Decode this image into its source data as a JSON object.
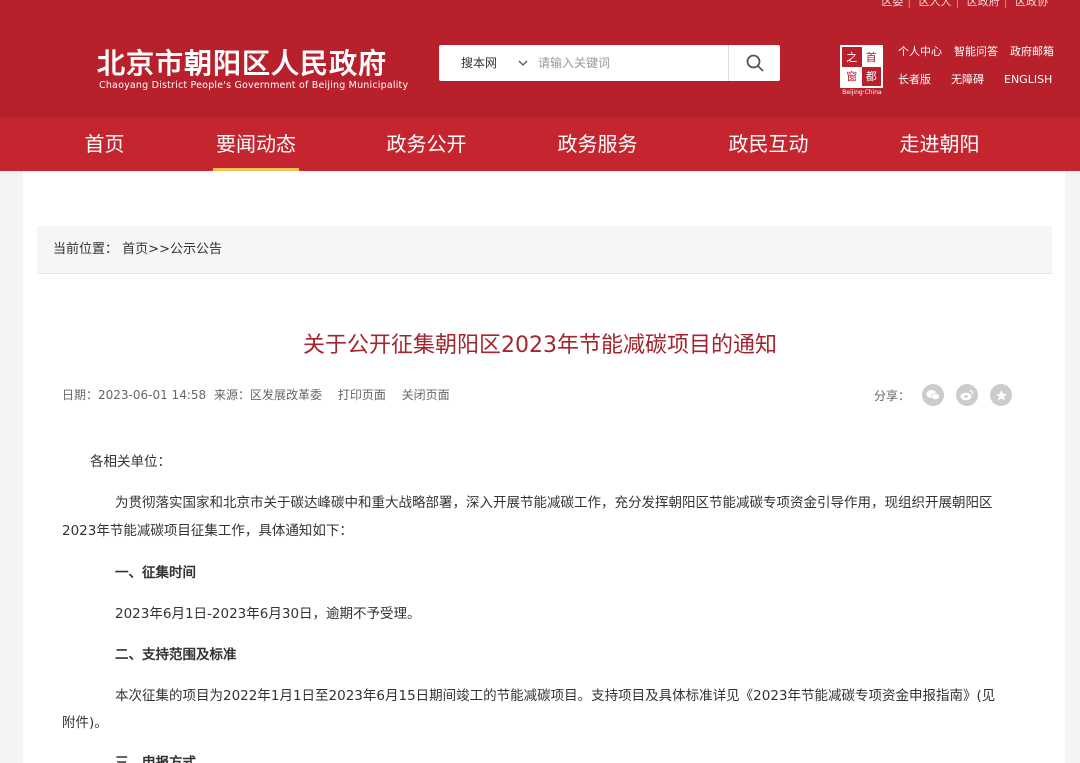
{
  "header": {
    "top_links": [
      "区委",
      "区人大",
      "区政府",
      "区政协"
    ],
    "title": "北京市朝阳区人民政府",
    "subtitle": "Chaoyang District People's Government of Beijing Municipality",
    "search": {
      "scope": "搜本网",
      "placeholder": "请输入关键词"
    },
    "logo_chars": [
      "之",
      "首",
      "窗",
      "都"
    ],
    "logo_caption": "Beijing·China",
    "right_links_row1": [
      "个人中心",
      "智能问答",
      "政府邮箱"
    ],
    "right_links_row2": [
      "长者版",
      "无障碍",
      "ENGLISH"
    ]
  },
  "nav": {
    "items": [
      "首页",
      "要闻动态",
      "政务公开",
      "政务服务",
      "政民互动",
      "走进朝阳"
    ],
    "active_index": 1
  },
  "breadcrumb": {
    "label": "当前位置：",
    "home": "首页",
    "sep": ">>",
    "current": "公示公告"
  },
  "article": {
    "title": "关于公开征集朝阳区2023年节能减碳项目的通知",
    "meta_date": "日期：2023-06-01 14:58",
    "meta_source": "来源：区发展改革委",
    "print_label": "打印页面",
    "close_label": "关闭页面",
    "share_label": "分享：",
    "salutation": "各相关单位：",
    "intro_line1": "为贯彻落实国家和北京市关于碳达峰碳中和重大战略部署，深入开展节能减碳工作，充分发挥朝阳区节能减碳专项资金引导作用，现组织开展朝阳区",
    "intro_line2": "2023年节能减碳项目征集工作，具体通知如下：",
    "section1_title": "一、征集时间",
    "section1_text": "2023年6月1日-2023年6月30日，逾期不予受理。",
    "section2_title": "二、支持范围及标准",
    "section2_line1": "本次征集的项目为2022年1月1日至2023年6月15日期间竣工的节能减碳项目。支持项目及具体标准详见《2023年节能减碳专项资金申报指南》(见",
    "section2_line2": "附件)。",
    "section3_title": "三、申报方式"
  },
  "colors": {
    "brand_red": "#b8202c",
    "nav_red": "#c5252f",
    "title_red": "#a3262e",
    "active_underline": "#f3c35a"
  }
}
